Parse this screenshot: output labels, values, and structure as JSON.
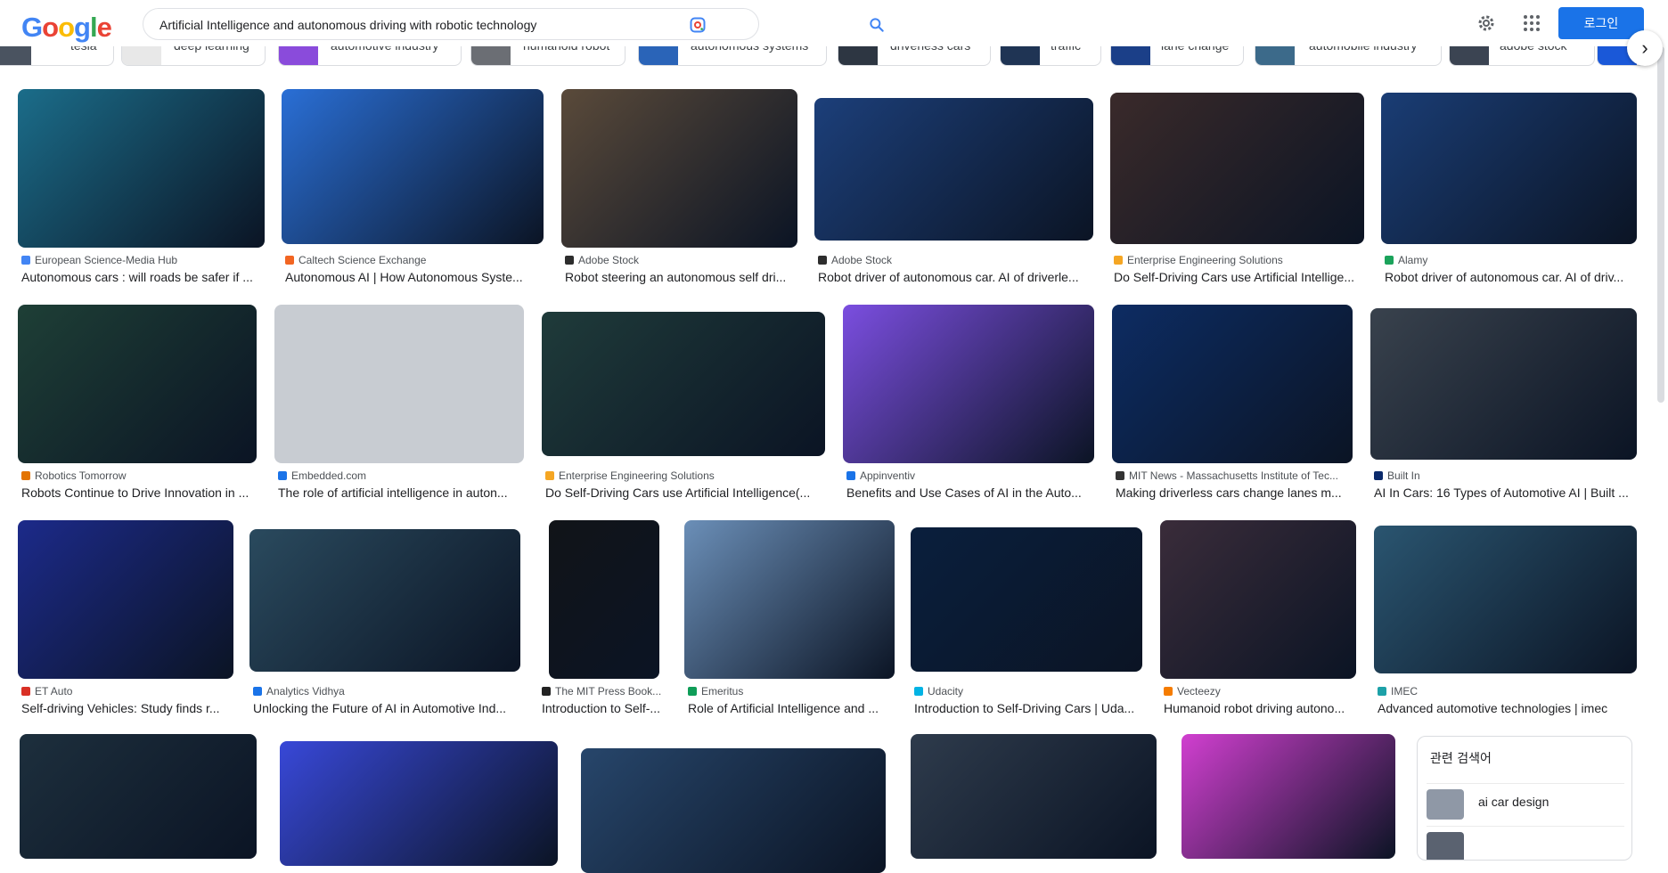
{
  "header": {
    "logo_letters": [
      "G",
      "o",
      "o",
      "g",
      "l",
      "e"
    ],
    "query": "Artificial Intelligence and autonomous driving with robotic technology",
    "login_label": "로그인"
  },
  "chips": [
    {
      "label": "tesla"
    },
    {
      "label": "deep learning"
    },
    {
      "label": "automotive industry"
    },
    {
      "label": "humanoid robot"
    },
    {
      "label": "autonomous systems"
    },
    {
      "label": "driverless cars"
    },
    {
      "label": "traffic"
    },
    {
      "label": "lane change"
    },
    {
      "label": "automobile industry"
    },
    {
      "label": "adobe stock"
    }
  ],
  "results": [
    {
      "source": "European Science-Media Hub",
      "title": "Autonomous cars : will roads be safer if ...",
      "color": "#1b6d8a"
    },
    {
      "source": "Caltech Science Exchange",
      "title": "Autonomous AI | How Autonomous Syste...",
      "color": "#2a6fd6"
    },
    {
      "source": "Adobe Stock",
      "title": "Robot steering an autonomous self dri...",
      "color": "#5a4a3a"
    },
    {
      "source": "Adobe Stock",
      "title": "Robot driver of autonomous car. AI of driverle...",
      "color": "#1c3f7a"
    },
    {
      "source": "Enterprise Engineering Solutions",
      "title": "Do Self-Driving Cars use Artificial Intellige...",
      "color": "#3a2a2a"
    },
    {
      "source": "Alamy",
      "title": "Robot driver of autonomous car. AI of driv...",
      "color": "#1a3d75"
    },
    {
      "source": "Robotics Tomorrow",
      "title": "Robots Continue to Drive Innovation in ...",
      "color": "#1e3f36"
    },
    {
      "source": "Embedded.com",
      "title": "The role of artificial intelligence in auton...",
      "color": "#c8ccd2"
    },
    {
      "source": "Enterprise Engineering Solutions",
      "title": "Do Self-Driving Cars use Artificial Intelligence(...",
      "color": "#1f3b3a"
    },
    {
      "source": "Appinventiv",
      "title": "Benefits and Use Cases of AI in the Auto...",
      "color": "#7b4ee0"
    },
    {
      "source": "MIT News - Massachusetts Institute of Tec...",
      "title": "Making driverless cars change lanes m...",
      "color": "#0d2c63"
    },
    {
      "source": "Built In",
      "title": "AI In Cars: 16 Types of Automotive AI | Built ...",
      "color": "#39424d"
    },
    {
      "source": "ET Auto",
      "title": "Self-driving Vehicles: Study finds r...",
      "color": "#1c2a8a"
    },
    {
      "source": "Analytics Vidhya",
      "title": "Unlocking the Future of AI in Automotive Ind...",
      "color": "#2a4a5e"
    },
    {
      "source": "The MIT Press Book...",
      "title": "Introduction to Self-...",
      "color": "#111418"
    },
    {
      "source": "Emeritus",
      "title": "Role of Artificial Intelligence and ...",
      "color": "#6b8fb8"
    },
    {
      "source": "Udacity",
      "title": "Introduction to Self-Driving Cars | Uda...",
      "color": "#0a1f3d"
    },
    {
      "source": "Vecteezy",
      "title": "Humanoid robot driving autono...",
      "color": "#3a2c3a"
    },
    {
      "source": "IMEC",
      "title": "Advanced automotive technologies | imec",
      "color": "#2a5570"
    }
  ],
  "row4_colors": [
    "#1d2f3d",
    "#3848d8",
    "#27466b",
    "#2e3b4c",
    "#d13fd0"
  ],
  "related": {
    "heading": "관련 검색어",
    "items": [
      {
        "label": "ai car design"
      }
    ]
  },
  "colors": {
    "accent": "#1a73e8"
  }
}
